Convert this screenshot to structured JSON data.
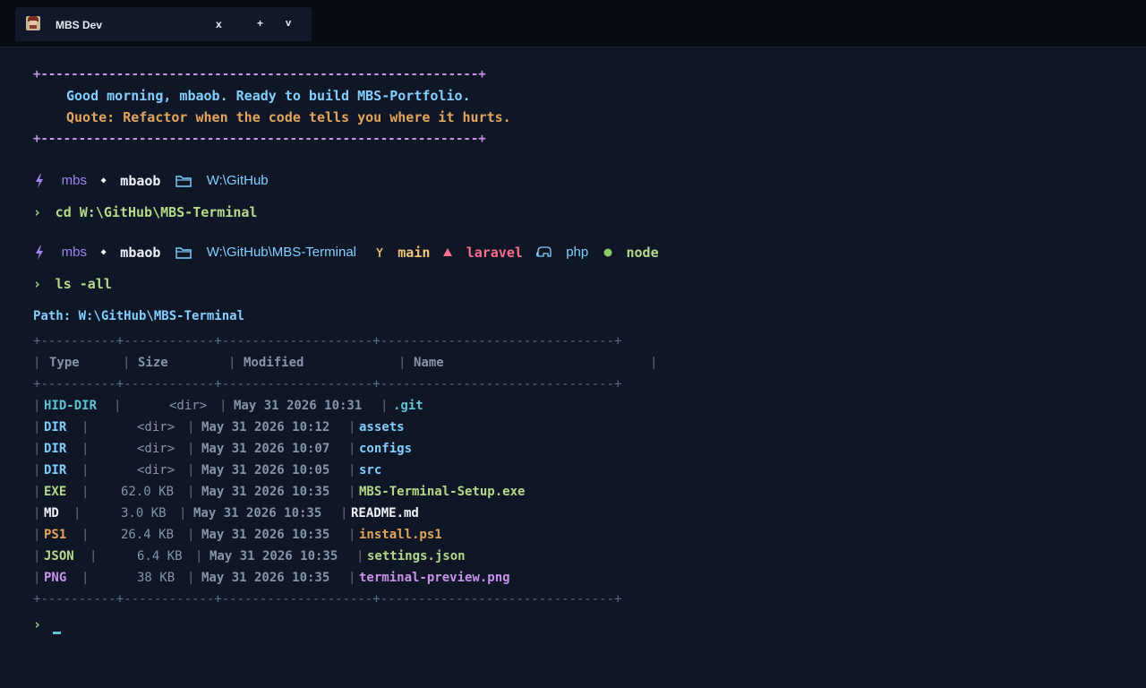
{
  "titlebar": {
    "tab_title": "MBS Dev",
    "close_label": "x",
    "new_tab_label": "+",
    "dropdown_label": "v",
    "icon": "avatar-icon"
  },
  "banner": {
    "border": "+----------------------------------------------------------+",
    "greeting": "Good morning, mbaob. Ready to build MBS-Portfolio.",
    "quote": "Quote: Refactor when the code tells you where it hurts."
  },
  "prompt1": {
    "host": "mbs",
    "user": "mbaob",
    "path": "W:\\GitHub",
    "command": "cd W:\\GitHub\\MBS-Terminal"
  },
  "prompt2": {
    "host": "mbs",
    "user": "mbaob",
    "path": "W:\\GitHub\\MBS-Terminal",
    "branch": "main",
    "laravel": "laravel",
    "php": "php",
    "node": "node",
    "command": "ls -all"
  },
  "listing": {
    "path_line": "Path: W:\\GitHub\\MBS-Terminal",
    "border": "+----------+------------+--------------------+-------------------------------+",
    "headers": [
      "Type",
      "Size",
      "Modified",
      "Name"
    ],
    "rows": [
      {
        "type": "HID-DIR",
        "size": "<dir>",
        "modified": "May 31 2026 10:31",
        "name": ".git"
      },
      {
        "type": "DIR",
        "size": "<dir>",
        "modified": "May 31 2026 10:12",
        "name": "assets"
      },
      {
        "type": "DIR",
        "size": "<dir>",
        "modified": "May 31 2026 10:07",
        "name": "configs"
      },
      {
        "type": "DIR",
        "size": "<dir>",
        "modified": "May 31 2026 10:05",
        "name": "src"
      },
      {
        "type": "EXE",
        "size": "62.0 KB",
        "modified": "May 31 2026 10:35",
        "name": "MBS-Terminal-Setup.exe"
      },
      {
        "type": "MD",
        "size": "3.0 KB",
        "modified": "May 31 2026 10:35",
        "name": "README.md"
      },
      {
        "type": "PS1",
        "size": "26.4 KB",
        "modified": "May 31 2026 10:35",
        "name": "install.ps1"
      },
      {
        "type": "JSON",
        "size": "6.4 KB",
        "modified": "May 31 2026 10:35",
        "name": "settings.json"
      },
      {
        "type": "PNG",
        "size": "38 KB",
        "modified": "May 31 2026 10:35",
        "name": "terminal-preview.png"
      }
    ]
  },
  "final_prompt": "›",
  "colors": {
    "background": "#0f1626",
    "purple": "#c792ea",
    "blue": "#82cfff",
    "orange": "#e3a55c",
    "green": "#b5d98a",
    "teal": "#5fc3d4"
  }
}
